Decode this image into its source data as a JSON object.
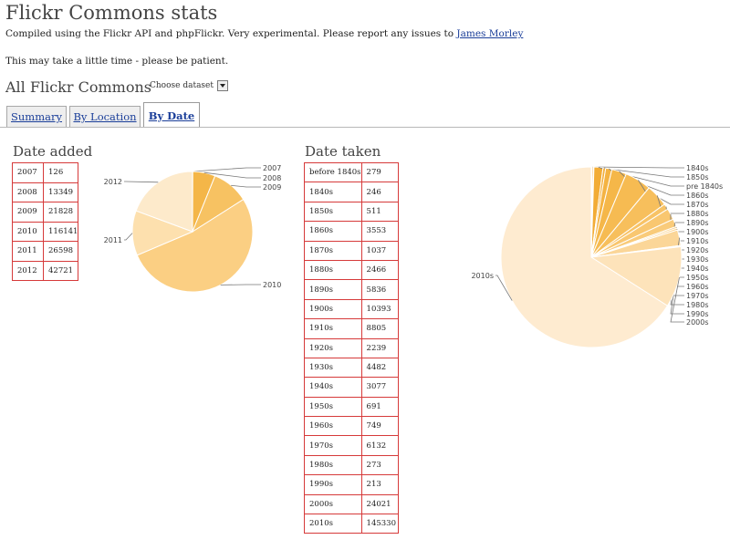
{
  "page": {
    "title": "Flickr Commons stats",
    "subtitle_text": "Compiled using the Flickr API and phpFlickr. Very experimental. Please report any issues to",
    "subtitle_link": "James Morley",
    "patience": "This may take a little time - please be patient.",
    "section_title": "All Flickr Commons",
    "dataset_select": "Choose dataset"
  },
  "tabs": [
    {
      "label": "Summary",
      "active": false
    },
    {
      "label": "By Location",
      "active": false
    },
    {
      "label": "By Date",
      "active": true
    }
  ],
  "date_added": {
    "title": "Date added",
    "rows": [
      {
        "label": "2007",
        "value": "126"
      },
      {
        "label": "2008",
        "value": "13349"
      },
      {
        "label": "2009",
        "value": "21828"
      },
      {
        "label": "2010",
        "value": "116141"
      },
      {
        "label": "2011",
        "value": "26598"
      },
      {
        "label": "2012",
        "value": "42721"
      }
    ]
  },
  "date_taken": {
    "title": "Date taken",
    "rows": [
      {
        "label": "before 1840s",
        "value": "279"
      },
      {
        "label": "1840s",
        "value": "246"
      },
      {
        "label": "1850s",
        "value": "511"
      },
      {
        "label": "1860s",
        "value": "3553"
      },
      {
        "label": "1870s",
        "value": "1037"
      },
      {
        "label": "1880s",
        "value": "2466"
      },
      {
        "label": "1890s",
        "value": "5836"
      },
      {
        "label": "1900s",
        "value": "10393"
      },
      {
        "label": "1910s",
        "value": "8805"
      },
      {
        "label": "1920s",
        "value": "2239"
      },
      {
        "label": "1930s",
        "value": "4482"
      },
      {
        "label": "1940s",
        "value": "3077"
      },
      {
        "label": "1950s",
        "value": "691"
      },
      {
        "label": "1960s",
        "value": "749"
      },
      {
        "label": "1970s",
        "value": "6132"
      },
      {
        "label": "1980s",
        "value": "273"
      },
      {
        "label": "1990s",
        "value": "213"
      },
      {
        "label": "2000s",
        "value": "24021"
      },
      {
        "label": "2010s",
        "value": "145330"
      }
    ]
  },
  "chart_data": [
    {
      "type": "pie",
      "title": "",
      "categories": [
        "2007",
        "2008",
        "2009",
        "2010",
        "2011",
        "2012"
      ],
      "values": [
        126,
        13349,
        21828,
        116141,
        26598,
        42721
      ],
      "colors": [
        "#f0a830",
        "#f4b648",
        "#f7c262",
        "#fbcf83",
        "#fde0ae",
        "#fdeacb"
      ]
    },
    {
      "type": "pie",
      "title": "",
      "categories": [
        "1840s",
        "1850s",
        "pre 1840s",
        "1860s",
        "1870s",
        "1880s",
        "1890s",
        "1900s",
        "1910s",
        "1920s",
        "1930s",
        "1940s",
        "1950s",
        "1960s",
        "1970s",
        "1980s",
        "1990s",
        "2000s",
        "2010s"
      ],
      "values": [
        246,
        511,
        279,
        3553,
        1037,
        2466,
        5836,
        10393,
        8805,
        2239,
        4482,
        3077,
        691,
        749,
        6132,
        273,
        213,
        24021,
        145330
      ],
      "colors": [
        "#f0a32a",
        "#f1a72e",
        "#f1a931",
        "#f2ac36",
        "#f3af3b",
        "#f4b342",
        "#f5b749",
        "#f6bb52",
        "#f7bf5c",
        "#f8c366",
        "#f9c770",
        "#f9cb7a",
        "#facf84",
        "#fbd38e",
        "#fbd698",
        "#fcdaa2",
        "#fcdeae",
        "#fde3ba",
        "#feebd0"
      ]
    }
  ]
}
